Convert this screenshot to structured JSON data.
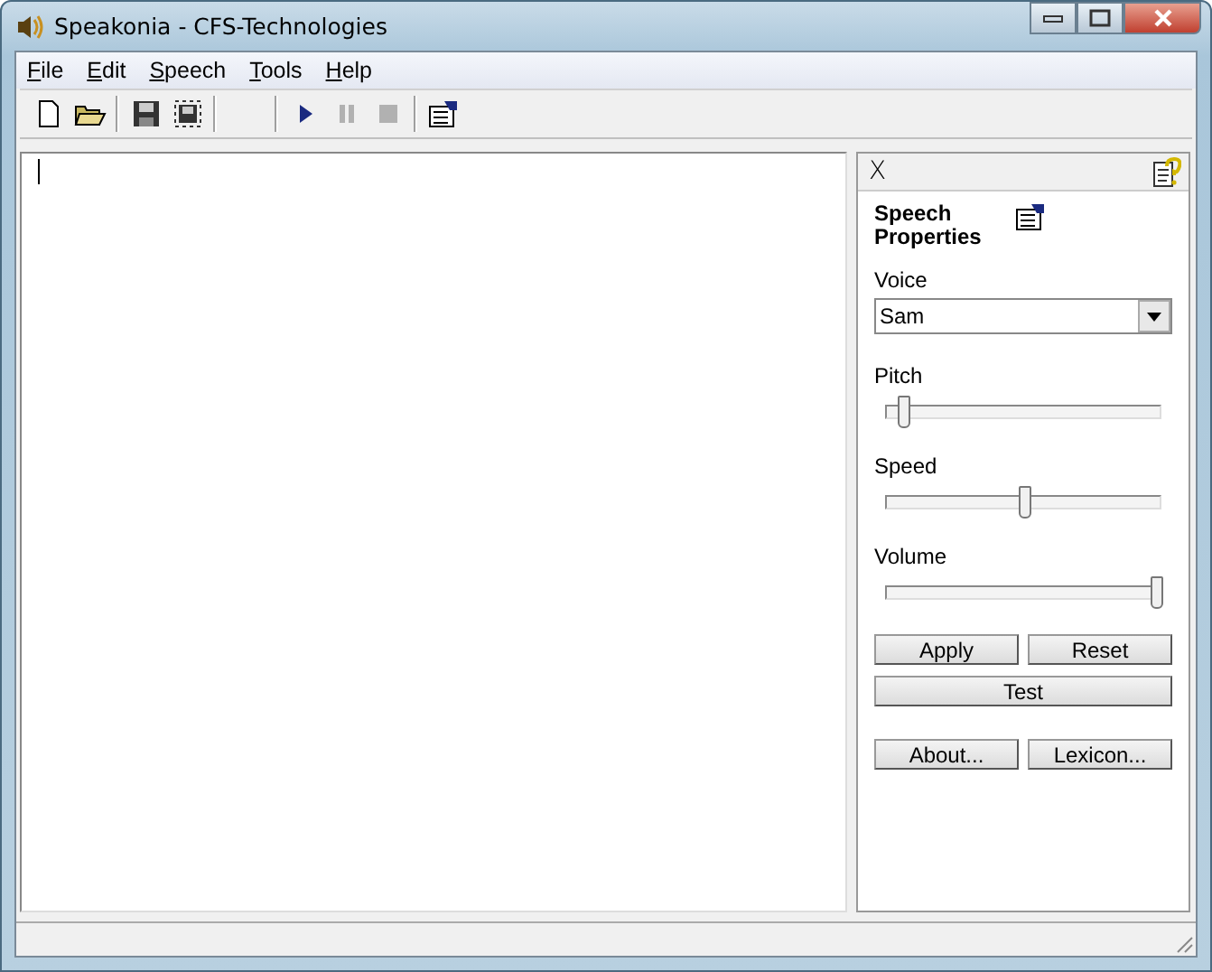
{
  "window": {
    "title": "Speakonia - CFS-Technologies"
  },
  "menu": [
    "File",
    "Edit",
    "Speech",
    "Tools",
    "Help"
  ],
  "toolbar": [
    {
      "kind": "new",
      "disabled": false
    },
    {
      "kind": "open",
      "disabled": false
    },
    {
      "kind": "sep"
    },
    {
      "kind": "save",
      "disabled": false
    },
    {
      "kind": "saveall",
      "disabled": false
    },
    {
      "kind": "sep"
    },
    {
      "kind": "gap"
    },
    {
      "kind": "sep"
    },
    {
      "kind": "play",
      "disabled": false
    },
    {
      "kind": "pause",
      "disabled": true
    },
    {
      "kind": "stop",
      "disabled": true
    },
    {
      "kind": "sep"
    },
    {
      "kind": "props",
      "disabled": false
    }
  ],
  "panel": {
    "close": "X",
    "title": "Speech Properties",
    "voice_label": "Voice",
    "voice": "Sam",
    "sliders": [
      {
        "label": "Pitch",
        "level": 0.05
      },
      {
        "label": "Speed",
        "level": 0.5
      },
      {
        "label": "Volume",
        "level": 1
      }
    ],
    "buttons": [
      [
        "Apply",
        "Reset"
      ],
      [
        "Test"
      ],
      [
        "About...",
        "Lexicon..."
      ]
    ]
  }
}
